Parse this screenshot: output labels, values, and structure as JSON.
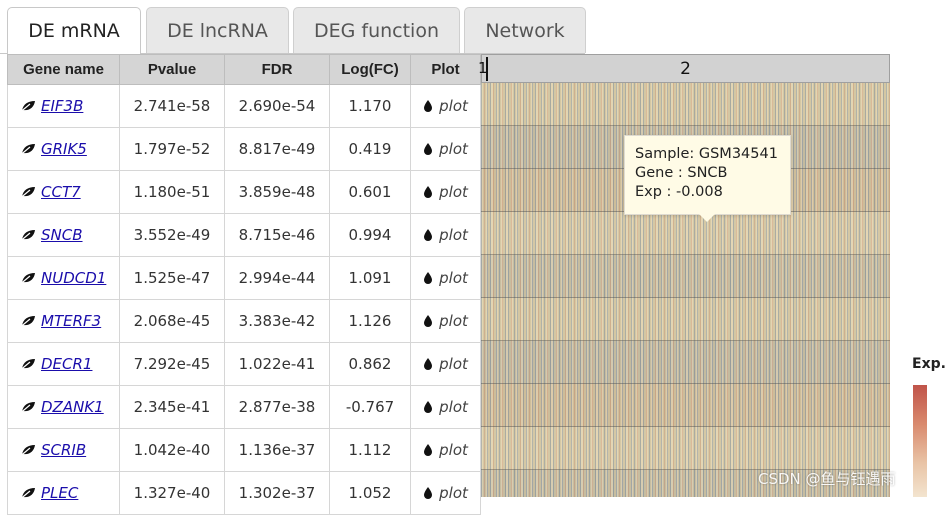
{
  "tabs": [
    {
      "label": "DE mRNA",
      "active": true
    },
    {
      "label": "DE lncRNA",
      "active": false
    },
    {
      "label": "DEG function",
      "active": false
    },
    {
      "label": "Network",
      "active": false
    }
  ],
  "table": {
    "headers": [
      "Gene name",
      "Pvalue",
      "FDR",
      "Log(FC)",
      "Plot"
    ],
    "rows": [
      {
        "gene": "EIF3B",
        "pvalue": "2.741e-58",
        "fdr": "2.690e-54",
        "logfc": "1.170",
        "plot": "plot"
      },
      {
        "gene": "GRIK5",
        "pvalue": "1.797e-52",
        "fdr": "8.817e-49",
        "logfc": "0.419",
        "plot": "plot"
      },
      {
        "gene": "CCT7",
        "pvalue": "1.180e-51",
        "fdr": "3.859e-48",
        "logfc": "0.601",
        "plot": "plot"
      },
      {
        "gene": "SNCB",
        "pvalue": "3.552e-49",
        "fdr": "8.715e-46",
        "logfc": "0.994",
        "plot": "plot"
      },
      {
        "gene": "NUDCD1",
        "pvalue": "1.525e-47",
        "fdr": "2.994e-44",
        "logfc": "1.091",
        "plot": "plot"
      },
      {
        "gene": "MTERF3",
        "pvalue": "2.068e-45",
        "fdr": "3.383e-42",
        "logfc": "1.126",
        "plot": "plot"
      },
      {
        "gene": "DECR1",
        "pvalue": "7.292e-45",
        "fdr": "1.022e-41",
        "logfc": "0.862",
        "plot": "plot"
      },
      {
        "gene": "DZANK1",
        "pvalue": "2.345e-41",
        "fdr": "2.877e-38",
        "logfc": "-0.767",
        "plot": "plot"
      },
      {
        "gene": "SCRIB",
        "pvalue": "1.042e-40",
        "fdr": "1.136e-37",
        "logfc": "1.112",
        "plot": "plot"
      },
      {
        "gene": "PLEC",
        "pvalue": "1.327e-40",
        "fdr": "1.302e-37",
        "logfc": "1.052",
        "plot": "plot"
      }
    ]
  },
  "heatmap": {
    "group_labels": [
      "1",
      "2"
    ],
    "legend_title": "Exp.",
    "tooltip": {
      "sample": "Sample: GSM34541",
      "gene": "Gene : SNCB",
      "exp": "Exp : -0.008"
    }
  },
  "watermark": "CSDN @鱼与钰遇雨",
  "colors": {
    "link": "#1a0dab",
    "header_bg": "#d5d5d5",
    "high_expression": "#c0544a",
    "low_expression": "#f3e4cf"
  }
}
